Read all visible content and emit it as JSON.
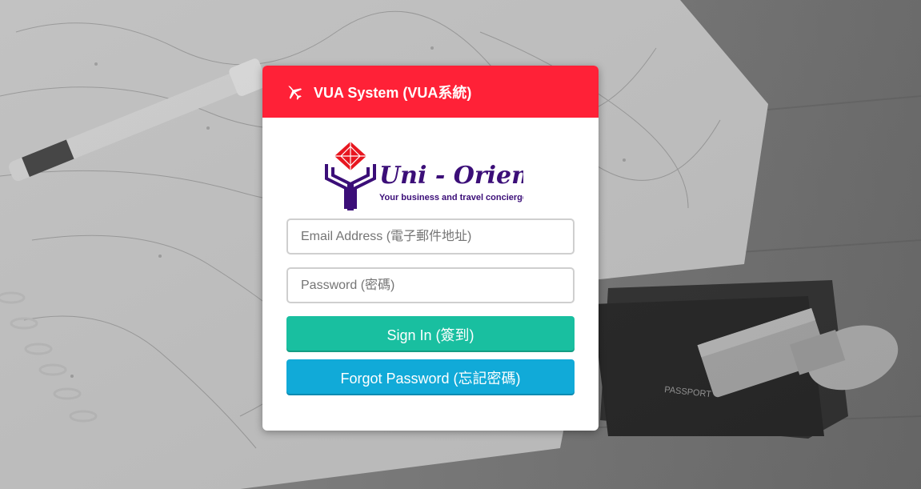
{
  "header": {
    "title": "VUA System (VUA系統)",
    "icon": "plane-icon"
  },
  "logo": {
    "name": "Uni - Orient",
    "tagline": "Your business and travel concierge",
    "colors": {
      "mark_red": "#e8161f",
      "mark_purple": "#3b0e78"
    }
  },
  "form": {
    "email": {
      "value": "",
      "placeholder": "Email Address (電子郵件地址)"
    },
    "password": {
      "value": "",
      "placeholder": "Password (密碼)"
    },
    "signin_label": "Sign In (簽到)",
    "forgot_label": "Forgot Password (忘記密碼)"
  },
  "colors": {
    "header": "#ff2137",
    "signin": "#19bfa0",
    "forgot": "#11aad8"
  },
  "background": {
    "description_icons": [
      "map",
      "pen",
      "notebook",
      "passport",
      "stamp"
    ],
    "passport_text": "PASSPORT"
  }
}
